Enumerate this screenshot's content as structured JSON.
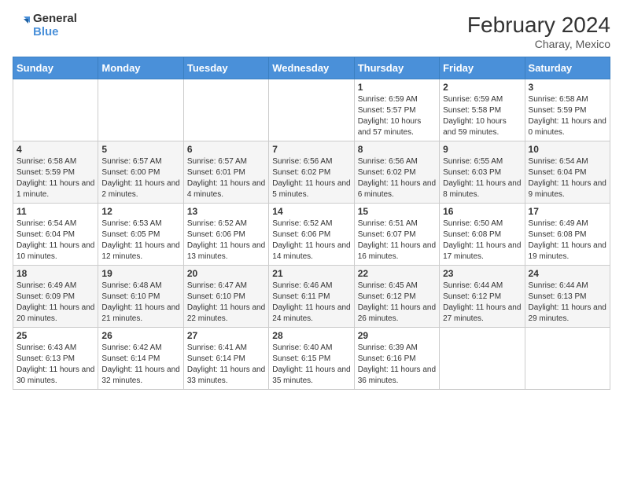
{
  "header": {
    "logo_line1": "General",
    "logo_line2": "Blue",
    "month_year": "February 2024",
    "location": "Charay, Mexico"
  },
  "days_of_week": [
    "Sunday",
    "Monday",
    "Tuesday",
    "Wednesday",
    "Thursday",
    "Friday",
    "Saturday"
  ],
  "weeks": [
    [
      {
        "day": "",
        "info": ""
      },
      {
        "day": "",
        "info": ""
      },
      {
        "day": "",
        "info": ""
      },
      {
        "day": "",
        "info": ""
      },
      {
        "day": "1",
        "info": "Sunrise: 6:59 AM\nSunset: 5:57 PM\nDaylight: 10 hours and 57 minutes."
      },
      {
        "day": "2",
        "info": "Sunrise: 6:59 AM\nSunset: 5:58 PM\nDaylight: 10 hours and 59 minutes."
      },
      {
        "day": "3",
        "info": "Sunrise: 6:58 AM\nSunset: 5:59 PM\nDaylight: 11 hours and 0 minutes."
      }
    ],
    [
      {
        "day": "4",
        "info": "Sunrise: 6:58 AM\nSunset: 5:59 PM\nDaylight: 11 hours and 1 minute."
      },
      {
        "day": "5",
        "info": "Sunrise: 6:57 AM\nSunset: 6:00 PM\nDaylight: 11 hours and 2 minutes."
      },
      {
        "day": "6",
        "info": "Sunrise: 6:57 AM\nSunset: 6:01 PM\nDaylight: 11 hours and 4 minutes."
      },
      {
        "day": "7",
        "info": "Sunrise: 6:56 AM\nSunset: 6:02 PM\nDaylight: 11 hours and 5 minutes."
      },
      {
        "day": "8",
        "info": "Sunrise: 6:56 AM\nSunset: 6:02 PM\nDaylight: 11 hours and 6 minutes."
      },
      {
        "day": "9",
        "info": "Sunrise: 6:55 AM\nSunset: 6:03 PM\nDaylight: 11 hours and 8 minutes."
      },
      {
        "day": "10",
        "info": "Sunrise: 6:54 AM\nSunset: 6:04 PM\nDaylight: 11 hours and 9 minutes."
      }
    ],
    [
      {
        "day": "11",
        "info": "Sunrise: 6:54 AM\nSunset: 6:04 PM\nDaylight: 11 hours and 10 minutes."
      },
      {
        "day": "12",
        "info": "Sunrise: 6:53 AM\nSunset: 6:05 PM\nDaylight: 11 hours and 12 minutes."
      },
      {
        "day": "13",
        "info": "Sunrise: 6:52 AM\nSunset: 6:06 PM\nDaylight: 11 hours and 13 minutes."
      },
      {
        "day": "14",
        "info": "Sunrise: 6:52 AM\nSunset: 6:06 PM\nDaylight: 11 hours and 14 minutes."
      },
      {
        "day": "15",
        "info": "Sunrise: 6:51 AM\nSunset: 6:07 PM\nDaylight: 11 hours and 16 minutes."
      },
      {
        "day": "16",
        "info": "Sunrise: 6:50 AM\nSunset: 6:08 PM\nDaylight: 11 hours and 17 minutes."
      },
      {
        "day": "17",
        "info": "Sunrise: 6:49 AM\nSunset: 6:08 PM\nDaylight: 11 hours and 19 minutes."
      }
    ],
    [
      {
        "day": "18",
        "info": "Sunrise: 6:49 AM\nSunset: 6:09 PM\nDaylight: 11 hours and 20 minutes."
      },
      {
        "day": "19",
        "info": "Sunrise: 6:48 AM\nSunset: 6:10 PM\nDaylight: 11 hours and 21 minutes."
      },
      {
        "day": "20",
        "info": "Sunrise: 6:47 AM\nSunset: 6:10 PM\nDaylight: 11 hours and 22 minutes."
      },
      {
        "day": "21",
        "info": "Sunrise: 6:46 AM\nSunset: 6:11 PM\nDaylight: 11 hours and 24 minutes."
      },
      {
        "day": "22",
        "info": "Sunrise: 6:45 AM\nSunset: 6:12 PM\nDaylight: 11 hours and 26 minutes."
      },
      {
        "day": "23",
        "info": "Sunrise: 6:44 AM\nSunset: 6:12 PM\nDaylight: 11 hours and 27 minutes."
      },
      {
        "day": "24",
        "info": "Sunrise: 6:44 AM\nSunset: 6:13 PM\nDaylight: 11 hours and 29 minutes."
      }
    ],
    [
      {
        "day": "25",
        "info": "Sunrise: 6:43 AM\nSunset: 6:13 PM\nDaylight: 11 hours and 30 minutes."
      },
      {
        "day": "26",
        "info": "Sunrise: 6:42 AM\nSunset: 6:14 PM\nDaylight: 11 hours and 32 minutes."
      },
      {
        "day": "27",
        "info": "Sunrise: 6:41 AM\nSunset: 6:14 PM\nDaylight: 11 hours and 33 minutes."
      },
      {
        "day": "28",
        "info": "Sunrise: 6:40 AM\nSunset: 6:15 PM\nDaylight: 11 hours and 35 minutes."
      },
      {
        "day": "29",
        "info": "Sunrise: 6:39 AM\nSunset: 6:16 PM\nDaylight: 11 hours and 36 minutes."
      },
      {
        "day": "",
        "info": ""
      },
      {
        "day": "",
        "info": ""
      }
    ]
  ]
}
